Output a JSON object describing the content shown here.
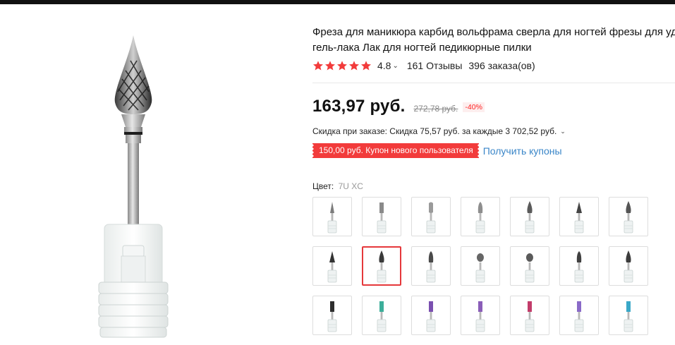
{
  "product": {
    "title_line1": "Фреза для маникюра карбид вольфрама сверла для ногтей фрезы для удал",
    "title_line2": "гель-лака Лак для ногтей педикюрные пилки",
    "rating": "4.8",
    "reviews": "161 Отзывы",
    "orders": "396 заказа(ов)",
    "stars": 5
  },
  "pricing": {
    "price": "163,97 руб.",
    "old_price": "272,78 руб.",
    "discount": "-40%",
    "order_discount": "Скидка при заказе: Скидка 75,57 руб. за каждые 3 702,52 руб.",
    "coupon_badge": "150,00 руб. Купон нового пользователя",
    "get_coupons": "Получить купоны"
  },
  "color": {
    "label": "Цвет:",
    "value": "7U XC",
    "options": [
      {
        "head": "#7c7c7c",
        "shape": "needle",
        "selected": false
      },
      {
        "head": "#8a8a8a",
        "shape": "cylinder",
        "selected": false
      },
      {
        "head": "#9a9a9a",
        "shape": "barrel",
        "selected": false
      },
      {
        "head": "#8e8e8e",
        "shape": "bullet",
        "selected": false
      },
      {
        "head": "#5a5a5a",
        "shape": "flame",
        "selected": false
      },
      {
        "head": "#444444",
        "shape": "cone",
        "selected": false
      },
      {
        "head": "#555555",
        "shape": "flame",
        "selected": false
      },
      {
        "head": "#333333",
        "shape": "cone",
        "selected": false
      },
      {
        "head": "#3a3a3a",
        "shape": "flame",
        "selected": true
      },
      {
        "head": "#4a4a4a",
        "shape": "bullet",
        "selected": false
      },
      {
        "head": "#666666",
        "shape": "ball",
        "selected": false
      },
      {
        "head": "#5a5a5a",
        "shape": "ball",
        "selected": false
      },
      {
        "head": "#404040",
        "shape": "bullet",
        "selected": false
      },
      {
        "head": "#3c3c3c",
        "shape": "flame",
        "selected": false
      },
      {
        "head": "#2e2e2e",
        "shape": "cylinder",
        "selected": false
      },
      {
        "head": "#3cae9a",
        "shape": "cylinder",
        "selected": false
      },
      {
        "head": "#7a4fb0",
        "shape": "cylinder",
        "selected": false
      },
      {
        "head": "#8a5db8",
        "shape": "cylinder",
        "selected": false
      },
      {
        "head": "#c23c6a",
        "shape": "cylinder",
        "selected": false
      },
      {
        "head": "#8a6ac8",
        "shape": "cylinder",
        "selected": false
      },
      {
        "head": "#3aa8c8",
        "shape": "cylinder",
        "selected": false
      }
    ]
  },
  "icons": {
    "star": "star-icon",
    "chevron": "chevron-down-icon"
  },
  "colors": {
    "accent": "#f23b3b",
    "link": "#3a86c8",
    "star": "#f23b3b"
  }
}
